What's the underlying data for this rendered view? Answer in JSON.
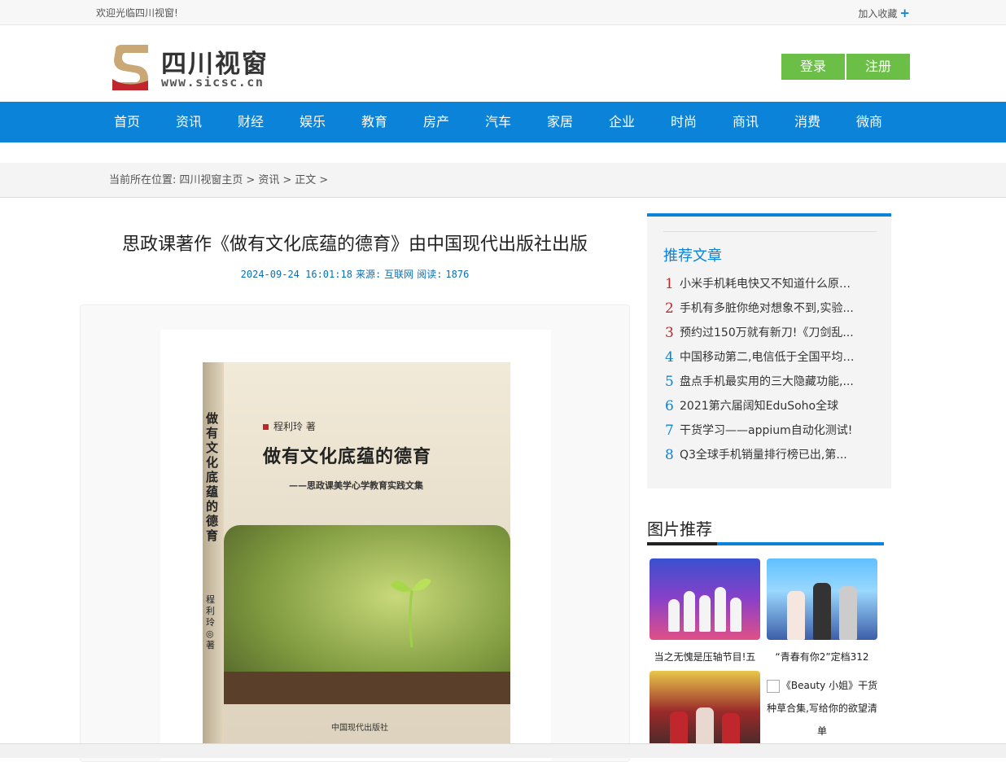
{
  "topbar": {
    "welcome": "欢迎光临四川视窗!",
    "favorite": "加入收藏",
    "favorite_icon": "plus-icon"
  },
  "logo": {
    "name": "四川视窗",
    "url": "www.sicsc.cn"
  },
  "auth": {
    "login": "登录",
    "register": "注册"
  },
  "nav": [
    "首页",
    "资讯",
    "财经",
    "娱乐",
    "教育",
    "房产",
    "汽车",
    "家居",
    "企业",
    "时尚",
    "商讯",
    "消费",
    "微商"
  ],
  "breadcrumb": {
    "prefix": "当前所在位置:",
    "home": "四川视窗主页",
    "sep": ">",
    "section": "资讯",
    "current": "正文",
    "tail": ">"
  },
  "article": {
    "title": "思政课著作《做有文化底蕴的德育》由中国现代出版社出版",
    "date": "2024-09-24 16:01:18",
    "source_label": "来源:",
    "source": "互联网",
    "reads_label": "阅读:",
    "reads": "1876"
  },
  "book": {
    "author": "程利玲 著",
    "title": "做有文化底蕴的德育",
    "subtitle": "——思政课美学心学教育实践文集",
    "spine_title": "做有文化底蕴的德育",
    "spine_author": "程利玲◎著",
    "publisher": "中国现代出版社"
  },
  "recommend": {
    "title": "推荐文章",
    "items": [
      {
        "n": "1",
        "color": "#c0272d",
        "text": "小米手机耗电快又不知道什么原因..."
      },
      {
        "n": "2",
        "color": "#c0272d",
        "text": "手机有多脏你绝对想象不到,实验..."
      },
      {
        "n": "3",
        "color": "#c0272d",
        "text": "预约过150万就有新刀!《刀剑乱..."
      },
      {
        "n": "4",
        "color": "#0a83d8",
        "text": "中国移动第二,电信低于全国平均值..."
      },
      {
        "n": "5",
        "color": "#0a83d8",
        "text": "盘点手机最实用的三大隐藏功能,..."
      },
      {
        "n": "6",
        "color": "#0a83d8",
        "text": "2021第六届阔知EduSoho全球"
      },
      {
        "n": "7",
        "color": "#0a83d8",
        "text": "干货学习——appium自动化测试!"
      },
      {
        "n": "8",
        "color": "#0a83d8",
        "text": "Q3全球手机销量排行榜已出,第..."
      }
    ]
  },
  "pictures": {
    "title": "图片推荐",
    "items": [
      {
        "caption": "当之无愧是压轴节目!五"
      },
      {
        "caption": "“青春有你2”定档312"
      },
      {
        "caption": "《Beauty 小姐》干货种草合集,写给你的欲望清单"
      }
    ]
  }
}
